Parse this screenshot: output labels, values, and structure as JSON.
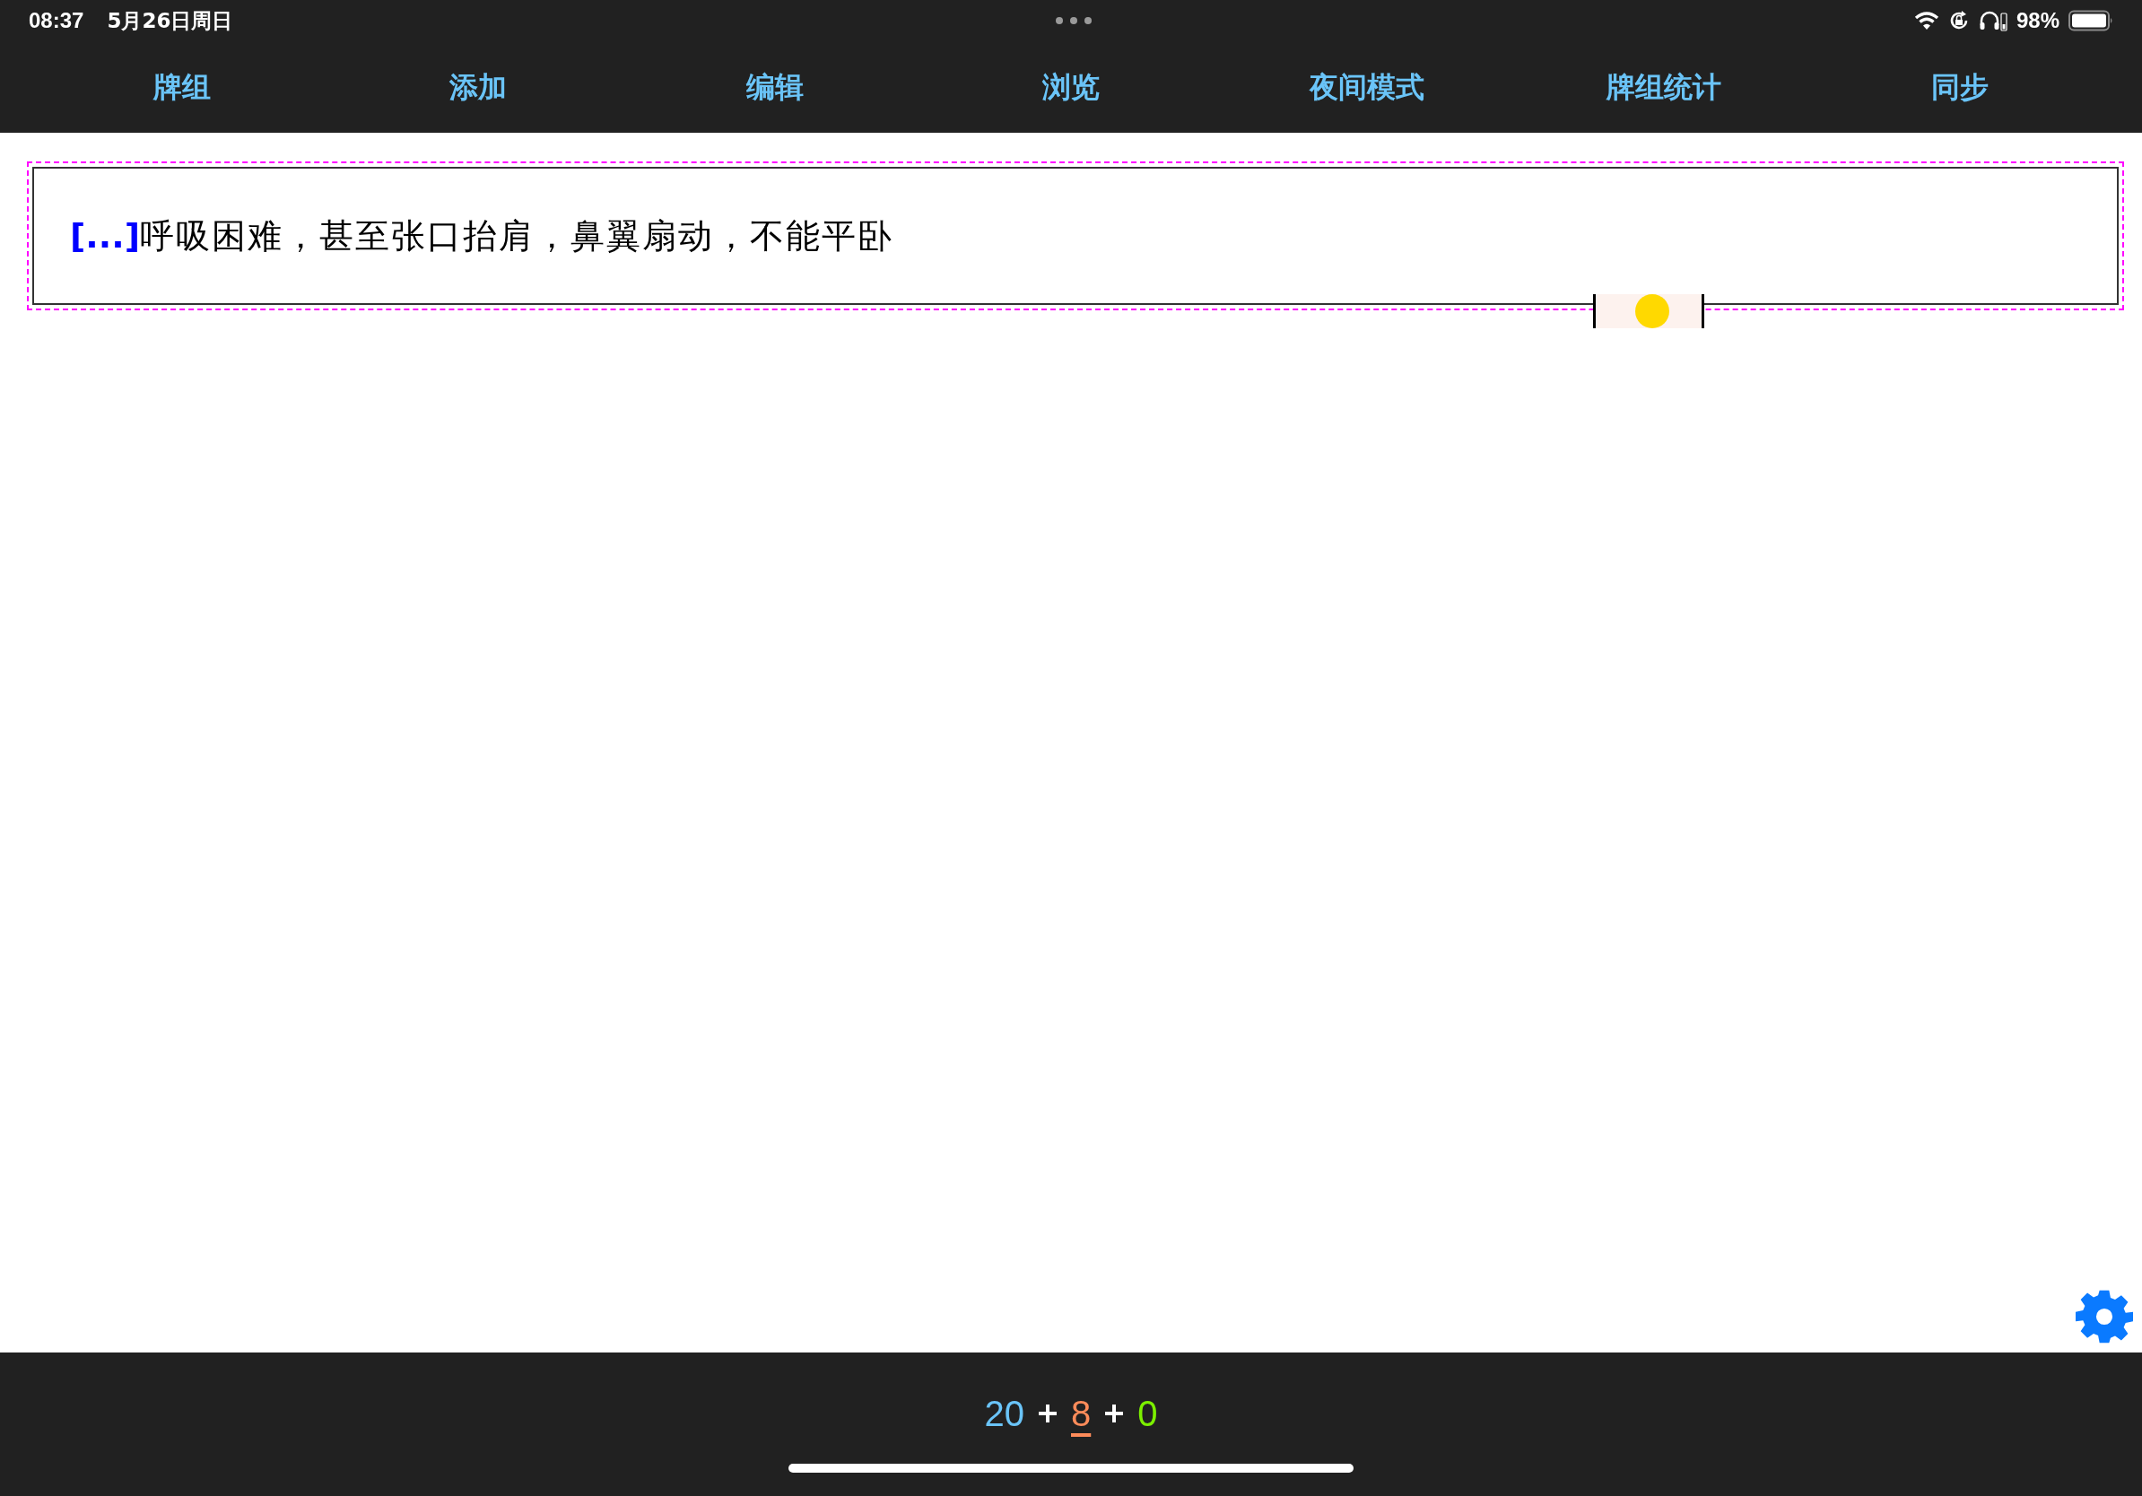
{
  "status_bar": {
    "time": "08:37",
    "date": "5月26日周日",
    "battery": "98%"
  },
  "nav": {
    "items": [
      {
        "label": "牌组"
      },
      {
        "label": "添加"
      },
      {
        "label": "编辑"
      },
      {
        "label": "浏览"
      },
      {
        "label": "夜间模式"
      },
      {
        "label": "牌组统计"
      },
      {
        "label": "同步"
      }
    ]
  },
  "card": {
    "cloze": "[...]",
    "text": "呼吸困难，甚至张口抬肩，鼻翼扇动，不能平卧"
  },
  "counts": [
    {
      "value": "20",
      "color": "#6ac4f8",
      "selected": false
    },
    {
      "value": "8",
      "color": "#ff8c5a",
      "selected": true
    },
    {
      "value": "0",
      "color": "#7cf000",
      "selected": false
    }
  ]
}
